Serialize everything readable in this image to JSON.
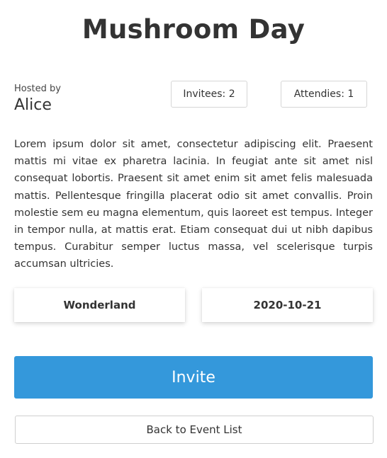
{
  "event": {
    "title": "Mushroom Day",
    "hosted_by_label": "Hosted by",
    "host_name": "Alice",
    "invitees_label": "Invitees: 2",
    "attendies_label": "Attendies: 1",
    "description": "Lorem ipsum dolor sit amet, consectetur adipiscing elit. Praesent mattis mi vitae ex pharetra lacinia. In feugiat ante sit amet nisl consequat lobortis. Praesent sit amet enim sit amet felis malesuada mattis. Pellentesque fringilla placerat odio sit amet convallis. Proin molestie sem eu magna elementum, quis laoreet est tempus. Integer in tempor nulla, at mattis erat. Etiam consequat dui ut nibh dapibus tempus. Curabitur semper luctus massa, vel scelerisque turpis accumsan ultricies.",
    "location": "Wonderland",
    "date": "2020-10-21"
  },
  "actions": {
    "invite_label": "Invite",
    "back_label": "Back to Event List"
  },
  "colors": {
    "primary": "#3498db",
    "text": "#333333",
    "border": "#d6d6d6"
  }
}
